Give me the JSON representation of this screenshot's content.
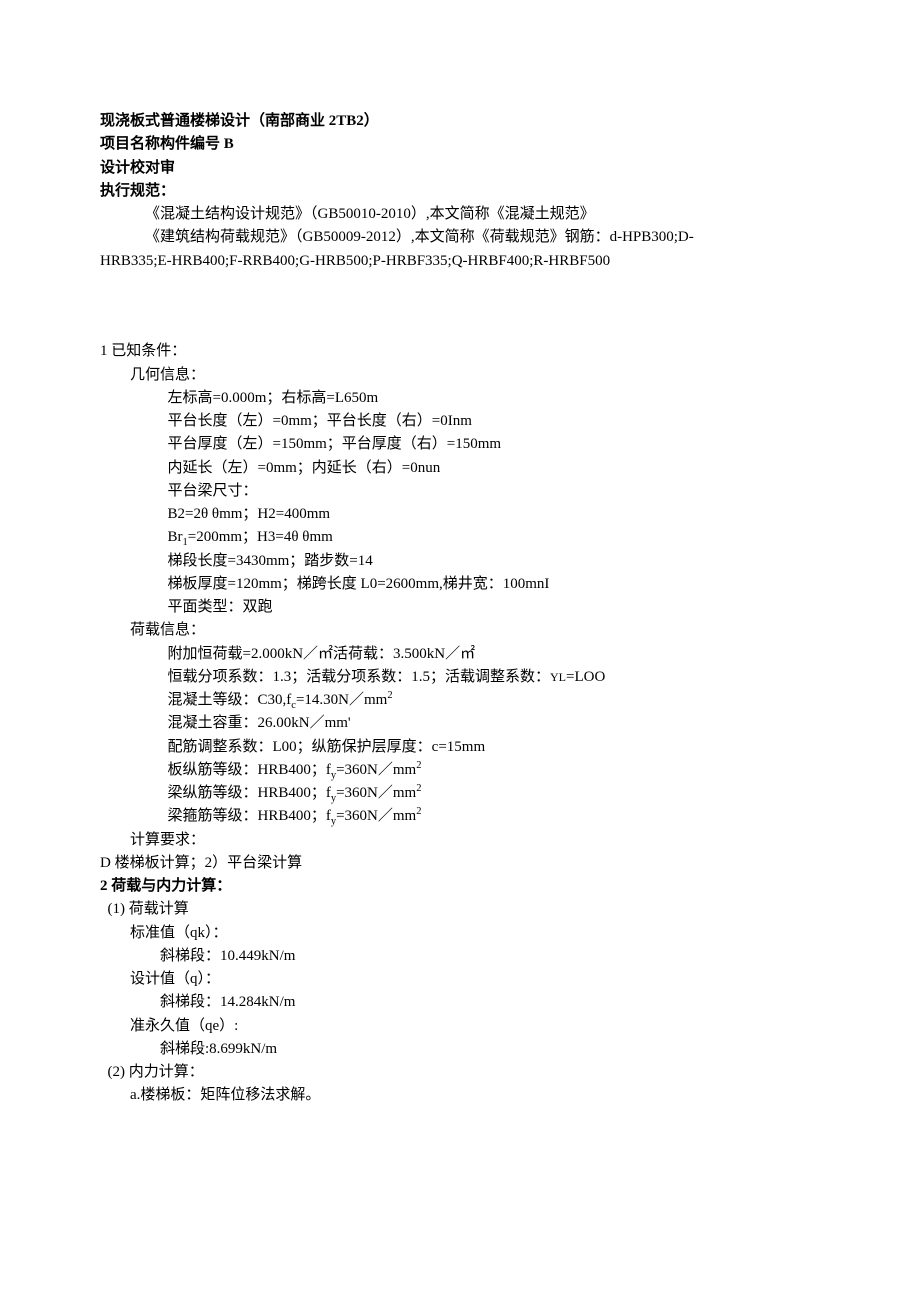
{
  "title_line": "现浇板式普通楼梯设计（南部商业 2TB2）",
  "line2": "项目名称构件编号 B",
  "line3": "设计校对审",
  "line4": "执行规范：",
  "spec1": "《混凝土结构设计规范》（GB50010-2010）,本文简称《混凝土规范》",
  "spec2_prefix": "《建筑结构荷载规范》（GB50009-2012）,本文简称《荷载规范》钢筋：d-HPB300;D-",
  "spec2_cont": "HRB335;E-HRB400;F-RRB400;G-HRB500;P-HRBF335;Q-HRBF400;R-HRBF500",
  "s1_head": "1 已知条件：",
  "s1_geom": "几何信息：",
  "g1": "左标高=0.000m；右标高=L650m",
  "g2": "平台长度（左）=0mm；平台长度（右）=0Inm",
  "g3": "平台厚度（左）=150mm；平台厚度（右）=150mm",
  "g4": "内延长（左）=0mm；内延长（右）=0nun",
  "g5": "平台梁尺寸：",
  "g6": "B2=2θ θmm；H2=400mm",
  "g7_a": "Br",
  "g7_b": "=200mm；H3=4θ θmm",
  "g8": "梯段长度=3430mm；踏步数=14",
  "g9": "梯板厚度=120mm；梯跨长度 L0=2600mm,梯井宽：100mnI",
  "g10": "平面类型：双跑",
  "s1_load": "荷载信息：",
  "l1_a": "附加恒荷载=2.000kN／㎡",
  "l1_b": "活荷载：3.500kN／㎡",
  "l2_a": "恒载分项系数：1.3；活载分项系数：1.5；活载调整系数：",
  "l2_b": "=LOO",
  "yl": "YL",
  "l3_a": "混凝土等级：C30,f",
  "l3_b": "=14.30N／mm",
  "l4": "混凝土容重：26.00kN／mm'",
  "l5": "配筋调整系数：L00；纵筋保护层厚度：c=15mm",
  "l6_a": "板纵筋等级：HRB400；f",
  "l6_b": "=360N／mm",
  "l7_a": "梁纵筋等级：HRB400；f",
  "l7_b": "=360N／mm",
  "l8_a": "梁箍筋等级：HRB400；f",
  "l8_b": "=360N／mm",
  "s1_req": "计算要求：",
  "s1_req_body": "D 楼梯板计算；2）平台梁计算",
  "s2_head": "2 荷载与内力计算：",
  "c1": "(1) 荷载计算",
  "c1_qk": "标准值（qk）：",
  "c1_qk_v": "斜梯段：10.449kN/m",
  "c1_q": "设计值（q）：",
  "c1_q_v": "斜梯段：14.284kN/m",
  "c1_qe": "准永久值（qe）:",
  "c1_qe_v": "斜梯段:8.699kN/m",
  "c2": "(2) 内力计算：",
  "c2_a": "a.楼梯板：矩阵位移法求解。",
  "sub_c": "c",
  "sub_y": "y",
  "sub_1": "1",
  "sup_2": "2"
}
